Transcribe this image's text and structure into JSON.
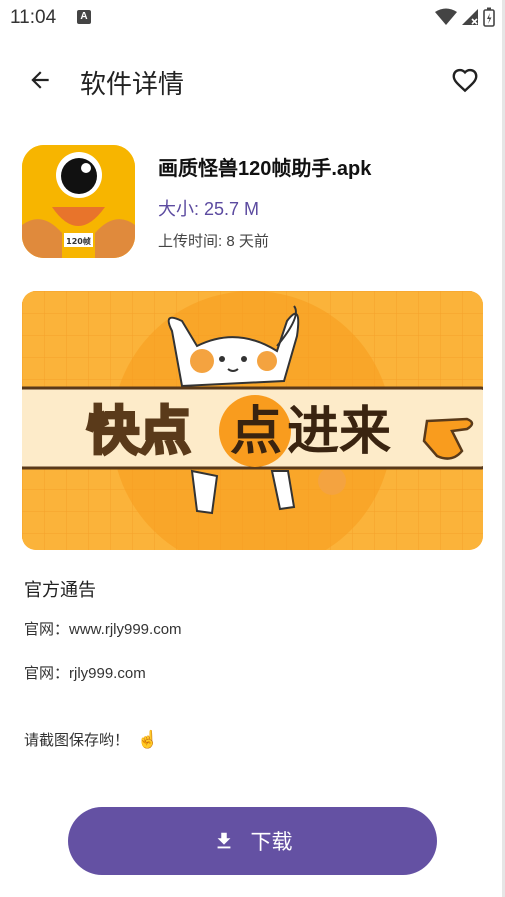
{
  "status_bar": {
    "time": "11:04",
    "notification_glyph": "A"
  },
  "app_bar": {
    "title": "软件详情"
  },
  "app": {
    "name": "画质怪兽120帧助手.apk",
    "size": "大小: 25.7 M",
    "upload_time": "上传时间: 8 天前",
    "icon_badge": "120帧"
  },
  "banner": {
    "text_left": "快点",
    "text_mid": "点",
    "text_right": "进来"
  },
  "notice": {
    "title": "官方通告",
    "line1": "官网：www.rjly999.com",
    "line2": "官网：rjly999.com",
    "line3": "请截图保存哟！",
    "line3_emoji": "☝"
  },
  "download": {
    "label": "下载"
  },
  "colors": {
    "accent": "#6451a3",
    "size_text": "#5c4ba0",
    "icon_bg": "#f7b500",
    "banner_bg": "#fbb33a"
  },
  "icons": [
    "back-arrow-icon",
    "heart-icon",
    "download-icon",
    "wifi-icon",
    "signal-icon",
    "battery-icon"
  ]
}
